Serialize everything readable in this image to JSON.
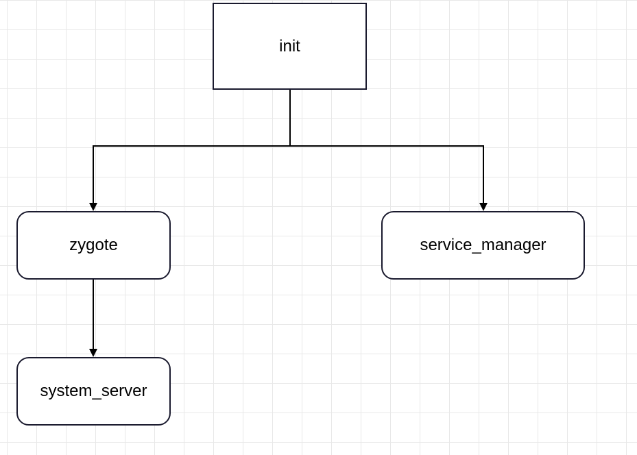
{
  "nodes": {
    "init": "init",
    "zygote": "zygote",
    "service_manager": "service_manager",
    "system_server": "system_server"
  }
}
